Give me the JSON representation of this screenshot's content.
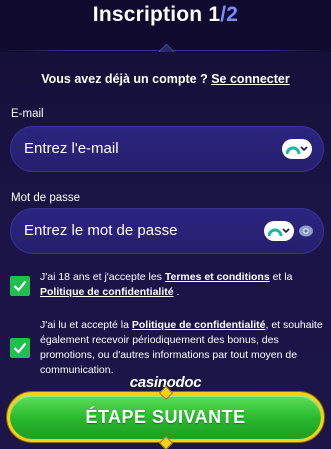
{
  "header": {
    "title_main": "Inscription 1",
    "title_slash": "/",
    "title_total": "2"
  },
  "login": {
    "prompt": "Vous avez déjà un compte ?",
    "link_label": "Se connecter"
  },
  "email": {
    "label": "E-mail",
    "placeholder": "Entrez l'e-mail"
  },
  "password": {
    "label": "Mot de passe",
    "placeholder": "Entrez le mot de passe"
  },
  "consent_age": {
    "checked": true,
    "text_1": "J'ai 18 ans et j'accepte les ",
    "link_terms": "Termes et conditions",
    "text_2": " et la ",
    "link_privacy": "Politique de confidentialité",
    "text_3": " ."
  },
  "consent_marketing": {
    "checked": true,
    "text_1": "J'ai lu et accepté la ",
    "link_privacy": "Politique de confidentialité",
    "text_2": ", et souhaite également recevoir périodiquement des bonus, des promotions, ou d'autres informations par tout moyen de communication."
  },
  "watermark": "casinodoc",
  "next_button": {
    "label": "ÉTAPE SUIVANTE"
  },
  "colors": {
    "background": "#1b1446",
    "input_fill": "#2c2580",
    "checkbox_green": "#1ec04f",
    "button_green": "#27b82c",
    "button_border": "#f4d21a",
    "accent_blue": "#7a8cff"
  }
}
